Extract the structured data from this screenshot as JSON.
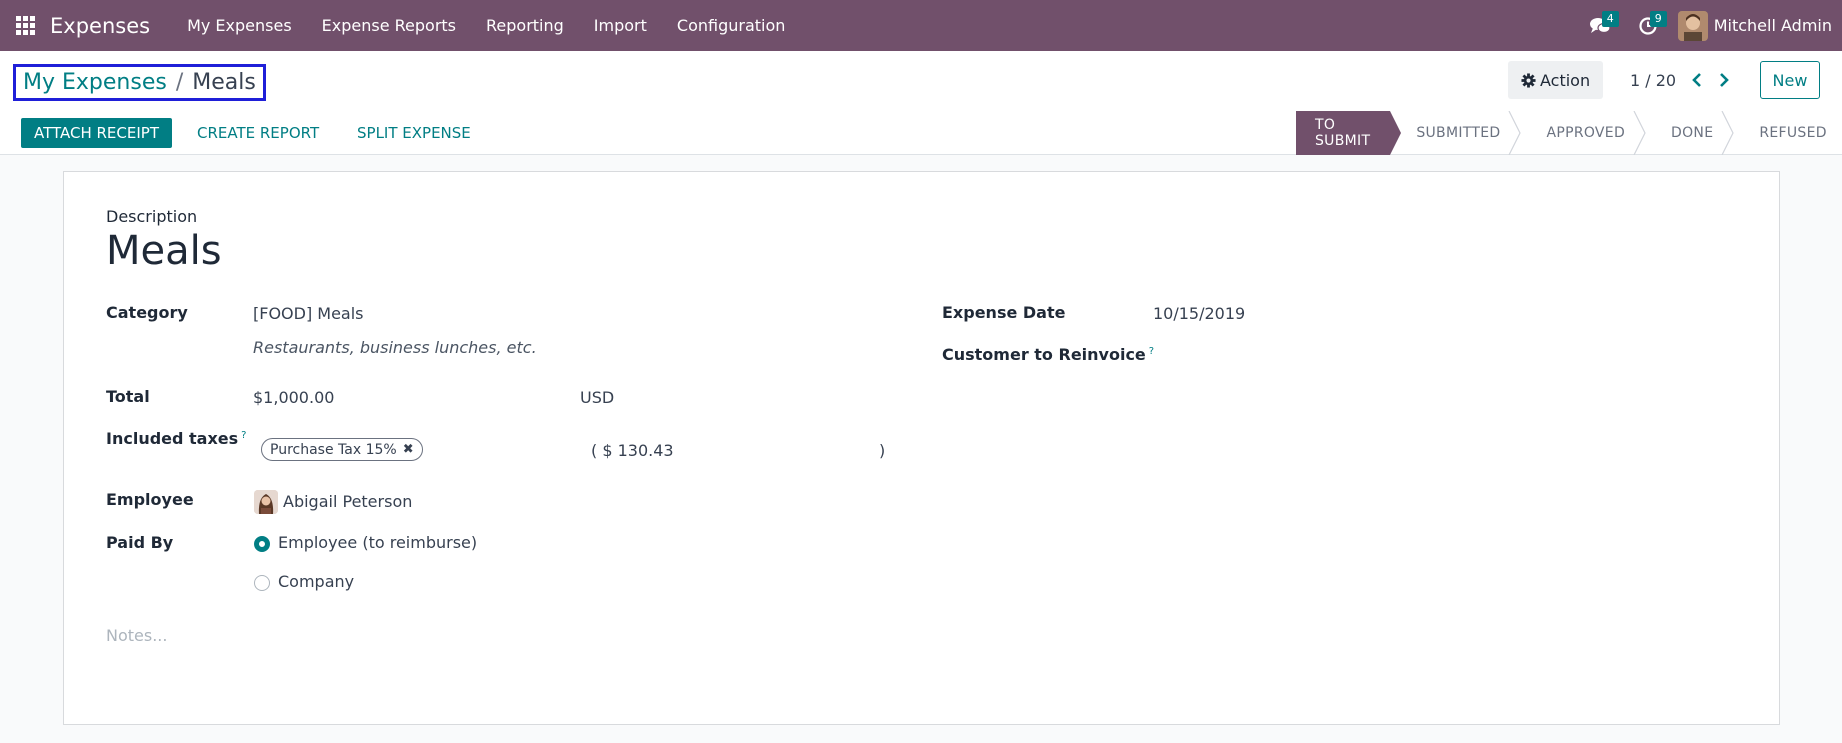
{
  "navbar": {
    "app_name": "Expenses",
    "menu": [
      "My Expenses",
      "Expense Reports",
      "Reporting",
      "Import",
      "Configuration"
    ],
    "messages_count": "4",
    "activities_count": "9",
    "user_name": "Mitchell Admin"
  },
  "breadcrumb": {
    "parent": "My Expenses",
    "separator": "/",
    "current": "Meals"
  },
  "control": {
    "action_label": "Action",
    "pager": "1 / 20",
    "new_label": "New",
    "attach_receipt": "ATTACH RECEIPT",
    "create_report": "CREATE REPORT",
    "split_expense": "SPLIT EXPENSE"
  },
  "status": {
    "stages": [
      "TO SUBMIT",
      "SUBMITTED",
      "APPROVED",
      "DONE",
      "REFUSED"
    ],
    "active": "TO SUBMIT"
  },
  "form": {
    "description_label": "Description",
    "description": "Meals",
    "category_label": "Category",
    "category": "[FOOD] Meals",
    "category_note": "Restaurants, business lunches, etc.",
    "total_label": "Total",
    "total": "$1,000.00",
    "currency": "USD",
    "included_taxes_label": "Included taxes",
    "help_mark": "?",
    "tax_tag": "Purchase Tax 15%",
    "tax_amount_open": "( $ 130.43",
    "tax_amount_close": ")",
    "employee_label": "Employee",
    "employee": "Abigail Peterson",
    "paid_by_label": "Paid By",
    "paid_by_options": [
      "Employee (to reimburse)",
      "Company"
    ],
    "paid_by_selected": "Employee (to reimburse)",
    "expense_date_label": "Expense Date",
    "expense_date": "10/15/2019",
    "customer_label": "Customer to Reinvoice",
    "notes_placeholder": "Notes..."
  },
  "colors": {
    "brand": "#71506b",
    "accent": "#017e84",
    "highlight_box": "#1f1fd8"
  }
}
